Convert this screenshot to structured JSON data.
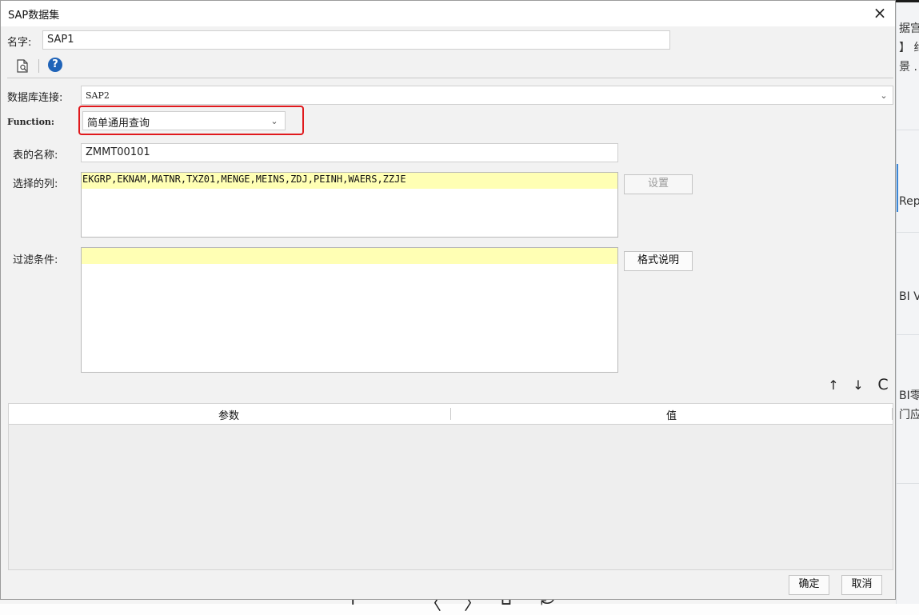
{
  "dialog": {
    "title": "SAP数据集",
    "close_glyph": "×"
  },
  "name_row": {
    "label": "名字:",
    "value": "SAP1"
  },
  "toolbar": {
    "preview_icon": "document-preview-icon",
    "help_icon": "help-icon",
    "help_glyph": "?"
  },
  "db_row": {
    "label": "数据库连接:",
    "value": "SAP2",
    "arrow": "⌄"
  },
  "function_row": {
    "label": "Function:",
    "value": "简单通用查询",
    "arrow": "⌄",
    "highlight_color": "#e0191d"
  },
  "table_name_row": {
    "label": "表的名称:",
    "value": "ZMMT00101"
  },
  "columns_row": {
    "label": "选择的列:",
    "value": "EKGRP,EKNAM,MATNR,TXZ01,MENGE,MEINS,ZDJ,PEINH,WAERS,ZZJE",
    "button": "设置"
  },
  "filter_row": {
    "label": "过滤条件:",
    "value": "",
    "button": "格式说明"
  },
  "param_tools": {
    "up": "↑",
    "down": "↓",
    "refresh": "C"
  },
  "param_table": {
    "headers": [
      "参数",
      "值"
    ],
    "rows": []
  },
  "footer": {
    "ok": "确定",
    "cancel": "取消"
  },
  "background_app": {
    "snippets": [
      "据宫",
      "】 约",
      "景 .",
      "Rep",
      "BI V",
      "BI零",
      "门应"
    ],
    "bottom_glyphs": [
      "+",
      "−",
      "〈",
      "〉",
      "⌂",
      "⤾"
    ]
  },
  "colors": {
    "dialog_bg": "#f2f2f2",
    "field_highlight": "#ffffb4",
    "help_blue": "#1f63b8"
  }
}
